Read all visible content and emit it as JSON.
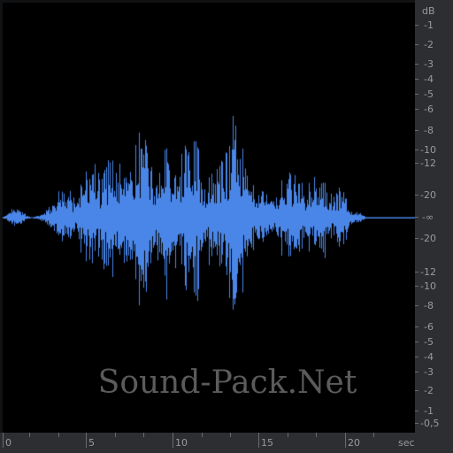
{
  "db_scale": {
    "unit": "dB",
    "labels_top": [
      "-1",
      "-2",
      "-3",
      "-4",
      "-5",
      "-6",
      "-8",
      "-10",
      "-12",
      "-20",
      "-∞"
    ],
    "labels_bottom": [
      "-20",
      "-12",
      "-10",
      "-8",
      "-6",
      "-5",
      "-4",
      "-3",
      "-2",
      "-1",
      "-0,5"
    ]
  },
  "time_scale": {
    "unit": "sec",
    "labels": [
      "0",
      "5",
      "10",
      "15",
      "20"
    ]
  },
  "watermark": "Sound-Pack.Net",
  "colors": {
    "waveform": "#4a86e8",
    "plot_background": "#000000",
    "ruler_background": "#2c2e31",
    "ruler_text": "#9a9a9a",
    "watermark": "#5b5b5b"
  }
}
